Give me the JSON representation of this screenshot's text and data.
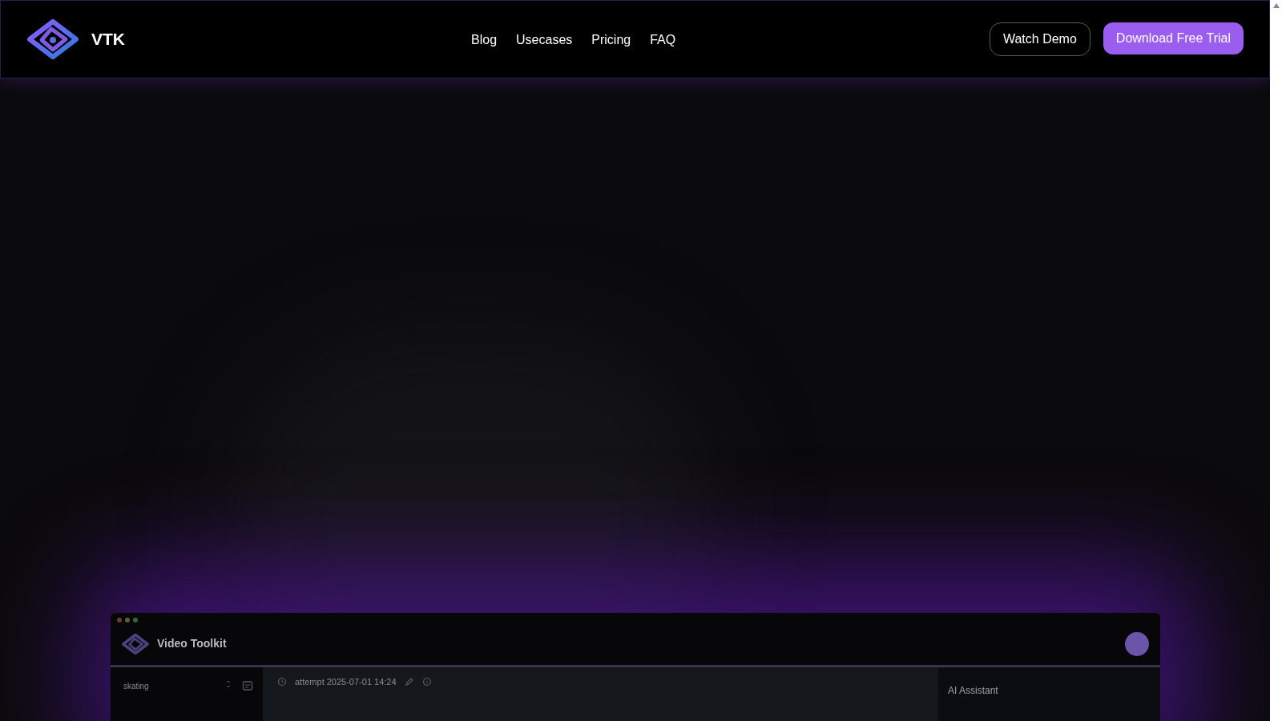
{
  "navbar": {
    "brand": "VTK",
    "links": [
      "Blog",
      "Usecases",
      "Pricing",
      "FAQ"
    ],
    "buttons": [
      {
        "kind": "outline",
        "label": "Watch Demo"
      },
      {
        "kind": "primary",
        "label": "Download Free Trial"
      }
    ]
  },
  "app_preview": {
    "title": "Video Toolkit",
    "project_select": "skating",
    "attempt_title": "attempt 2025-07-01 14:24",
    "assistant_title": "AI Assistant"
  }
}
